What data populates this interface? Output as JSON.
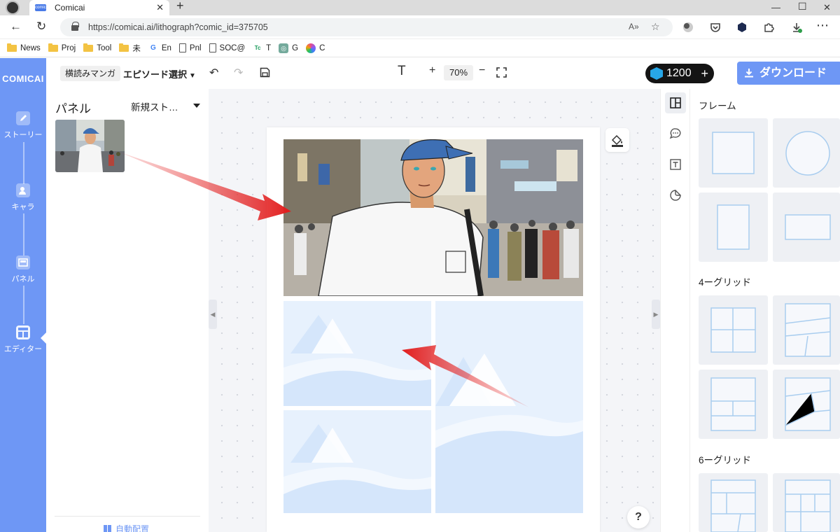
{
  "browser": {
    "tab_title": "Comicai",
    "favicon_text": "comicai",
    "url": "https://comicai.ai/lithograph?comic_id=375705",
    "read_aloud": "A»",
    "bookmarks": [
      {
        "label": "News",
        "kind": "folder"
      },
      {
        "label": "Proj",
        "kind": "folder"
      },
      {
        "label": "Tool",
        "kind": "folder"
      },
      {
        "label": "未",
        "kind": "folder"
      },
      {
        "label": "En",
        "kind": "google"
      },
      {
        "label": "Pnl",
        "kind": "doc"
      },
      {
        "label": "SOC@",
        "kind": "doc"
      },
      {
        "label": "T",
        "kind": "tc"
      },
      {
        "label": "G",
        "kind": "gpt"
      },
      {
        "label": "C",
        "kind": "copilot"
      }
    ]
  },
  "app": {
    "logo": "COMICAI",
    "nav": [
      {
        "label": "ストーリー",
        "icon": "pencil-icon"
      },
      {
        "label": "キャラ",
        "icon": "character-icon"
      },
      {
        "label": "パネル",
        "icon": "panel-icon"
      },
      {
        "label": "エディター",
        "icon": "editor-icon",
        "active": true
      }
    ],
    "toolbar": {
      "mode_chip": "横読みマンガ",
      "episode_label": "エピソード選択",
      "text_tool": "T",
      "zoom_in": "+",
      "zoom_level": "70%",
      "zoom_out": "−",
      "credits": "1200",
      "credits_plus": "+",
      "download": "ダウンロード"
    },
    "panel_list": {
      "title": "パネル",
      "story_select": "新規スト…",
      "auto_layout": "自動配置"
    },
    "canvas": {
      "help": "?"
    },
    "library": {
      "frame_header": "フレーム",
      "grid4_header": "4ーグリッド",
      "grid6_header": "6ーグリッド"
    },
    "accent_color": "#6e97f5"
  }
}
